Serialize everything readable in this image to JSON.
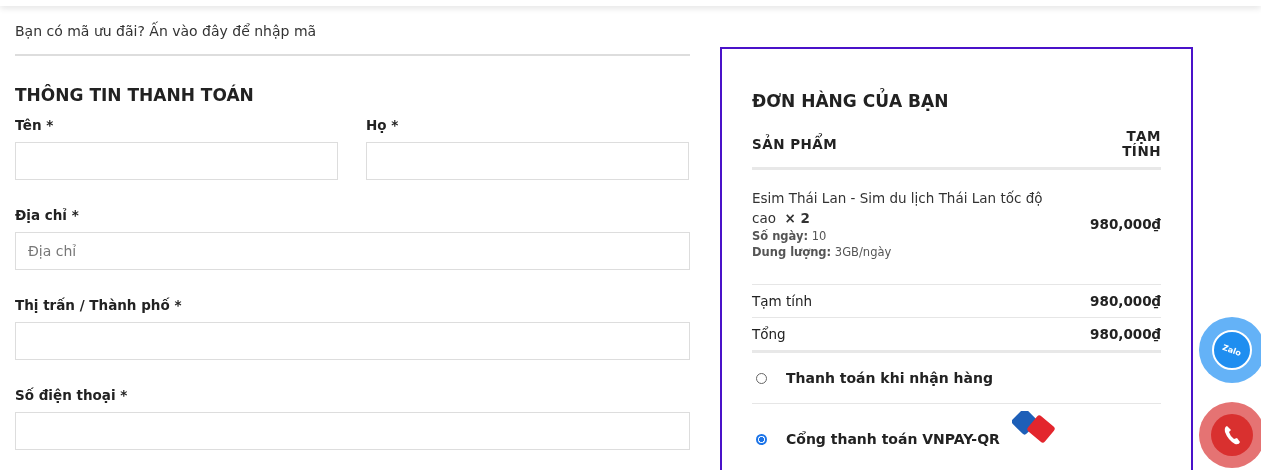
{
  "coupon_notice": "Bạn có mã ưu đãi? Ấn vào đây để nhập mã",
  "billing": {
    "title": "THÔNG TIN THANH TOÁN",
    "fields": [
      {
        "label": "Tên *",
        "half": true
      },
      {
        "label": "Họ *",
        "half": true
      },
      {
        "label": "Địa chỉ *",
        "half": false,
        "placeholder": "Địa chỉ"
      },
      {
        "label": "Thị trấn / Thành phố *",
        "half": false
      },
      {
        "label": "Số điện thoại *",
        "half": false
      }
    ]
  },
  "order": {
    "title": "ĐƠN HÀNG CỦA BẠN",
    "columns": [
      "SẢN PHẨM",
      "TẠM TÍNH"
    ],
    "items": [
      {
        "name": "Esim Thái Lan - Sim du lịch Thái Lan tốc độ cao",
        "quantity": "× 2",
        "price": "980,000₫",
        "meta": [
          {
            "key": "Số ngày:",
            "value": "10"
          },
          {
            "key": "Dung lượng:",
            "value": "3GB/ngày"
          }
        ]
      }
    ],
    "totals": [
      {
        "label": "Tạm tính",
        "value": "980,000₫"
      },
      {
        "label": "Tổng",
        "value": "980,000₫"
      }
    ],
    "payment_methods": [
      {
        "label": "Thanh toán khi nhận hàng",
        "selected": false,
        "logo": false
      },
      {
        "label": "Cổng thanh toán VNPAY-QR",
        "selected": true,
        "logo": true
      }
    ]
  },
  "floating_buttons": [
    {
      "kind": "zalo",
      "label": "Zalo"
    },
    {
      "kind": "phone"
    }
  ]
}
